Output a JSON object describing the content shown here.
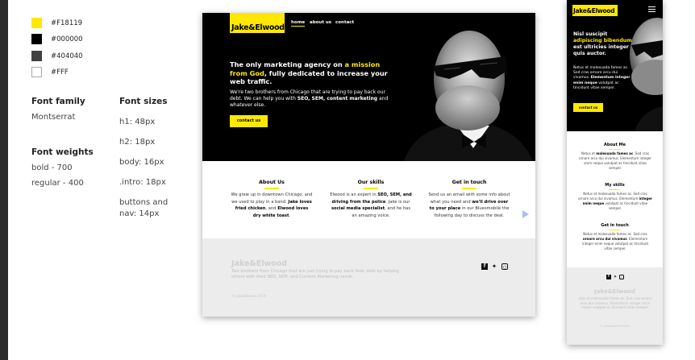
{
  "style_guide": {
    "colors": [
      {
        "hex": "#F18119",
        "label": "#F18119",
        "swatch": "#FFE800"
      },
      {
        "hex": "#000000",
        "label": "#000000",
        "swatch": "#000000"
      },
      {
        "hex": "#404040",
        "label": "#404040",
        "swatch": "#404040"
      },
      {
        "hex": "#FFF",
        "label": "#FFF",
        "swatch": "#FFFFFF"
      }
    ],
    "font_family_heading": "Font family",
    "font_family_value": "Montserrat",
    "font_weights_heading": "Font weights",
    "font_weights": [
      "bold - 700",
      "regular - 400"
    ],
    "font_sizes_heading": "Font sizes",
    "font_sizes": [
      "h1: 48px",
      "h2: 18px",
      "body: 16px",
      ".intro: 18px",
      "buttons and",
      "nav: 14px"
    ]
  },
  "desktop": {
    "logo": "Jake&Elwood",
    "nav": [
      "home",
      "about us",
      "contact"
    ],
    "hero_title_1": "The only marketing agency on ",
    "hero_title_highlight": "a mission from God",
    "hero_title_2": ", fully dedicated to increase your web traffic.",
    "hero_intro_1": "We're two brothers from Chicago that are trying to pay back our debt. We can help you with ",
    "hero_intro_bold": "SEO, SEM, content marketing",
    "hero_intro_2": " and whatever else.",
    "hero_button": "contact us",
    "columns": [
      {
        "title": "About Us",
        "t1": "We grew up in downtown Chicago, and we used to play in a band. ",
        "b1": "Jake loves fried chicken",
        "t2": ", and ",
        "b2": "Elwood loves dry white toast",
        "t3": "."
      },
      {
        "title": "Our skills",
        "t1": "Elwood is an expert in ",
        "b1": "SEO, SEM, and driving from the police",
        "t2": ". Jake is our ",
        "b2": "social media specialist",
        "t3": ", and he has an amazing voice."
      },
      {
        "title": "Get in touch",
        "t1": "Send us an email with some info about what you need and ",
        "b1": "we'll drive over to your place",
        "t2": " in our Bluesmobile the following day to discuss the deal.",
        "b2": "",
        "t3": ""
      }
    ],
    "footer_logo": "Jake&Elwood",
    "footer_text": "Two brothers from Chicago that are just trying to pay back their debt by helping others with their SEO, SEM, and Content Marketing needs.",
    "footer_copy": "© Jake&Elwood 2019"
  },
  "mobile": {
    "logo": "Jake&Elwood",
    "hero_title_1": "Nisl suscipit ",
    "hero_title_highlight": "adipiscing bibendum",
    "hero_title_2": " est ultricies integer quis auctor.",
    "hero_intro_1": "Netus et malesuada fames ac. Sed cras ornare arcu dui vivamus. ",
    "hero_intro_bold": "Elementum integer enim neque",
    "hero_intro_2": " volutpat ac tincidunt vitae semper.",
    "hero_button": "contact us",
    "sections": [
      {
        "title": "About Me",
        "t1": "Netus et ",
        "b1": "malesuada fames ac",
        "t2": ". Sed cras ornare arcu dui vivamus. Elementum integer enim neque volutpat ac tincidunt vitae semper.",
        "b2": "",
        "t3": ""
      },
      {
        "title": "My skills",
        "t1": "Netus et malesuada fames ac. Sed cras ornare arcu dui vivamus. Elementum ",
        "b1": "integer enim neque",
        "t2": " volutpat ac tincidunt vitae semper.",
        "b2": "",
        "t3": ""
      },
      {
        "title": "Get in touch",
        "t1": "Netus et malesuada fames ac. Sed cras ",
        "b1": "ornare arcu dui vivamus",
        "t2": ". Elementum integer enim neque volutpat ac tincidunt vitae semper.",
        "b2": "",
        "t3": ""
      }
    ],
    "footer_logo": "Jake&Elwood",
    "footer_text": "etus et malesuada fames ac. Sed cras ornare arcu dui vivamus. Elementum integer enim neque volutpat ac tincidunt vitae semper.",
    "footer_copy": "© Jake&Elwood 2019"
  },
  "colors": {
    "accent_yellow": "#FFE800",
    "black": "#000000",
    "dark_gray": "#404040",
    "white": "#FFFFFF"
  },
  "icons": [
    "facebook-icon",
    "twitter-icon",
    "instagram-icon",
    "menu-icon",
    "next-arrow-icon"
  ]
}
